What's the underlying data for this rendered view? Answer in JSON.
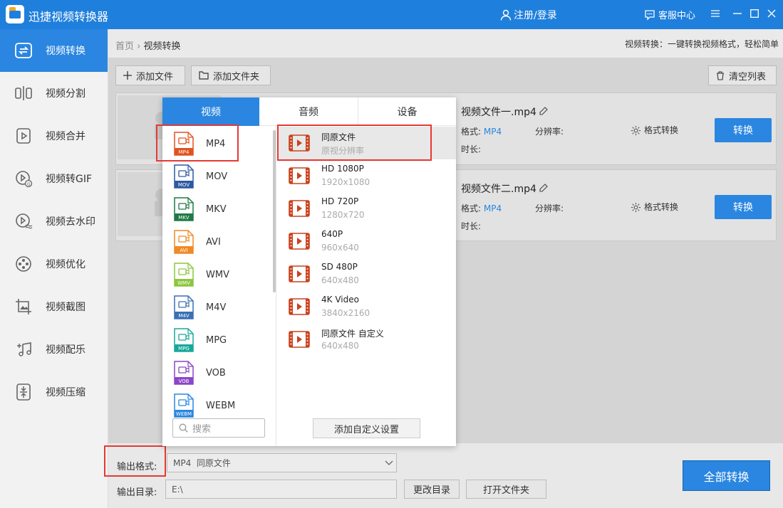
{
  "titlebar": {
    "app_title": "迅捷视频转换器",
    "login": "注册/登录",
    "service": "客服中心"
  },
  "sidebar": {
    "items": [
      {
        "label": "视频转换",
        "icon": "convert-icon"
      },
      {
        "label": "视频分割",
        "icon": "split-icon"
      },
      {
        "label": "视频合并",
        "icon": "merge-icon"
      },
      {
        "label": "视频转GIF",
        "icon": "gif-icon"
      },
      {
        "label": "视频去水印",
        "icon": "watermark-icon"
      },
      {
        "label": "视频优化",
        "icon": "film-reel-icon"
      },
      {
        "label": "视频截图",
        "icon": "screenshot-icon"
      },
      {
        "label": "视频配乐",
        "icon": "music-icon"
      },
      {
        "label": "视频压缩",
        "icon": "compress-icon"
      }
    ]
  },
  "breadcrumb": {
    "home": "首页",
    "sep": "›",
    "current": "视频转换"
  },
  "tagline": "视频转换：一键转换视频格式，轻松简单",
  "toolbar": {
    "add_file": "添加文件",
    "add_folder": "添加文件夹",
    "clear_list": "清空列表"
  },
  "files": [
    {
      "name": "视频文件一.mp4",
      "format_label": "格式:",
      "format_value": "MP4",
      "resolution_label": "分辨率:",
      "duration_label": "时长:",
      "format_convert": "格式转换",
      "convert": "转换"
    },
    {
      "name": "视频文件二.mp4",
      "format_label": "格式:",
      "format_value": "MP4",
      "resolution_label": "分辨率:",
      "duration_label": "时长:",
      "format_convert": "格式转换",
      "convert": "转换"
    }
  ],
  "panel": {
    "tabs": [
      "视频",
      "音频",
      "设备"
    ],
    "formats": [
      {
        "name": "MP4",
        "color": "#e0531f"
      },
      {
        "name": "MOV",
        "color": "#2c5aa0"
      },
      {
        "name": "MKV",
        "color": "#1f7a45"
      },
      {
        "name": "AVI",
        "color": "#f08a24"
      },
      {
        "name": "WMV",
        "color": "#8cc63f"
      },
      {
        "name": "M4V",
        "color": "#3b6fb6"
      },
      {
        "name": "MPG",
        "color": "#18a89a"
      },
      {
        "name": "VOB",
        "color": "#8a46c7"
      },
      {
        "name": "WEBM",
        "color": "#2a86e0"
      }
    ],
    "search_placeholder": "搜索",
    "resolutions": [
      {
        "name": "同原文件",
        "sub": "原视分辨率"
      },
      {
        "name": "HD 1080P",
        "sub": "1920x1080"
      },
      {
        "name": "HD 720P",
        "sub": "1280x720"
      },
      {
        "name": "640P",
        "sub": "960x640"
      },
      {
        "name": "SD 480P",
        "sub": "640x480"
      },
      {
        "name": "4K Video",
        "sub": "3840x2160"
      },
      {
        "name": "同原文件 自定义",
        "sub": "640x480"
      }
    ],
    "add_custom": "添加自定义设置"
  },
  "bottom": {
    "output_format_label": "输出格式:",
    "output_format_value": "MP4  同原文件",
    "output_dir_label": "输出目录:",
    "output_dir_value": "E:\\",
    "change_dir": "更改目录",
    "open_folder": "打开文件夹",
    "convert_all": "全部转换"
  },
  "colors": {
    "accent": "#2a86e0",
    "titlebar": "#1f7fdc",
    "highlight": "#e53935",
    "video_icon": "#c9421e"
  }
}
